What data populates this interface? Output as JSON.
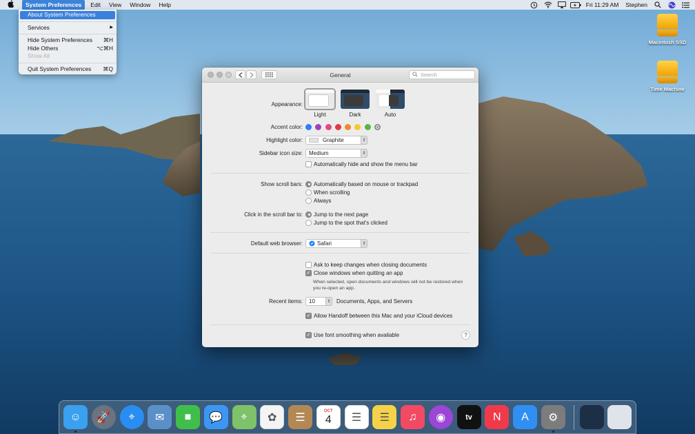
{
  "menubar": {
    "app": "System Preferences",
    "items": [
      "Edit",
      "View",
      "Window",
      "Help"
    ],
    "clock": "Fri 11:29 AM",
    "user": "Stephen",
    "icons": [
      "time-machine-icon",
      "wifi-icon",
      "airplay-icon",
      "battery-icon",
      "search-icon",
      "siri-icon",
      "control-list-icon"
    ]
  },
  "app_menu": {
    "about": "About System Preferences",
    "services": "Services",
    "services_arrow": "▶",
    "hide": "Hide System Preferences",
    "hide_shortcut": "⌘H",
    "hide_others": "Hide Others",
    "hide_others_shortcut": "⌥⌘H",
    "show_all": "Show All",
    "quit": "Quit System Preferences",
    "quit_shortcut": "⌘Q"
  },
  "desktop": {
    "disk1": "Macintosh SSD",
    "disk2": "Time Machine"
  },
  "window": {
    "title": "General",
    "search_placeholder": "Search",
    "appearance": {
      "label": "Appearance:",
      "options": [
        "Light",
        "Dark",
        "Auto"
      ],
      "selected": "Light"
    },
    "accent": {
      "label": "Accent color:",
      "colors": [
        "#2f7ef6",
        "#9a45b5",
        "#e5487f",
        "#e13a45",
        "#f0892c",
        "#f7c92e",
        "#5cb443",
        "#8c8c8c"
      ],
      "selected_index": 7
    },
    "highlight": {
      "label": "Highlight color:",
      "value": "Graphite"
    },
    "sidebar_icon": {
      "label": "Sidebar icon size:",
      "value": "Medium"
    },
    "menu_bar_autohide": {
      "label": "Automatically hide and show the menu bar",
      "checked": false
    },
    "scroll_bars": {
      "label": "Show scroll bars:",
      "options": [
        "Automatically based on mouse or trackpad",
        "When scrolling",
        "Always"
      ],
      "selected_index": 0
    },
    "scroll_click": {
      "label": "Click in the scroll bar to:",
      "options": [
        "Jump to the next page",
        "Jump to the spot that's clicked"
      ],
      "selected_index": 0
    },
    "browser": {
      "label": "Default web browser:",
      "value": "Safari"
    },
    "ask_keep_changes": {
      "label": "Ask to keep changes when closing documents",
      "checked": false
    },
    "close_windows": {
      "label": "Close windows when quitting an app",
      "checked": true,
      "note": "When selected, open documents and windows will not be restored when you re-open an app."
    },
    "recent_items": {
      "label": "Recent items:",
      "value": "10",
      "suffix": "Documents, Apps, and Servers"
    },
    "handoff": {
      "label": "Allow Handoff between this Mac and your iCloud devices",
      "checked": true
    },
    "font_smoothing": {
      "label": "Use font smoothing when available",
      "checked": true
    },
    "help": "?"
  },
  "dock": {
    "apps": [
      {
        "name": "finder",
        "color": "#3aa0f0",
        "running": true
      },
      {
        "name": "launchpad",
        "color": "#6b7280",
        "running": false
      },
      {
        "name": "safari",
        "color": "#2a8df3",
        "running": false
      },
      {
        "name": "mail",
        "color": "#5b8fc8",
        "running": false
      },
      {
        "name": "facetime",
        "color": "#3fbf4a",
        "running": false
      },
      {
        "name": "messages",
        "color": "#3a97f5",
        "running": false
      },
      {
        "name": "maps",
        "color": "#7ec26a",
        "running": false
      },
      {
        "name": "photos",
        "color": "#f4f4f4",
        "running": false
      },
      {
        "name": "contacts",
        "color": "#b38855",
        "running": false
      },
      {
        "name": "calendar",
        "color": "#ffffff",
        "running": false
      },
      {
        "name": "reminders",
        "color": "#ffffff",
        "running": false
      },
      {
        "name": "notes",
        "color": "#f5d24a",
        "running": false
      },
      {
        "name": "music",
        "color": "#f24a64",
        "running": false
      },
      {
        "name": "podcasts",
        "color": "#9b46d6",
        "running": false
      },
      {
        "name": "tv",
        "color": "#111111",
        "running": false
      },
      {
        "name": "news",
        "color": "#f03a4a",
        "running": false
      },
      {
        "name": "app-store",
        "color": "#2f8ff2",
        "running": false
      },
      {
        "name": "system-preferences",
        "color": "#7c7c7c",
        "running": true
      }
    ],
    "calendar_month": "OCT",
    "calendar_day": "4",
    "tv_label": "tv",
    "extras": [
      {
        "name": "downloads-stack",
        "color": "#1c2f45"
      },
      {
        "name": "trash",
        "color": "#dfe4ea"
      }
    ]
  }
}
